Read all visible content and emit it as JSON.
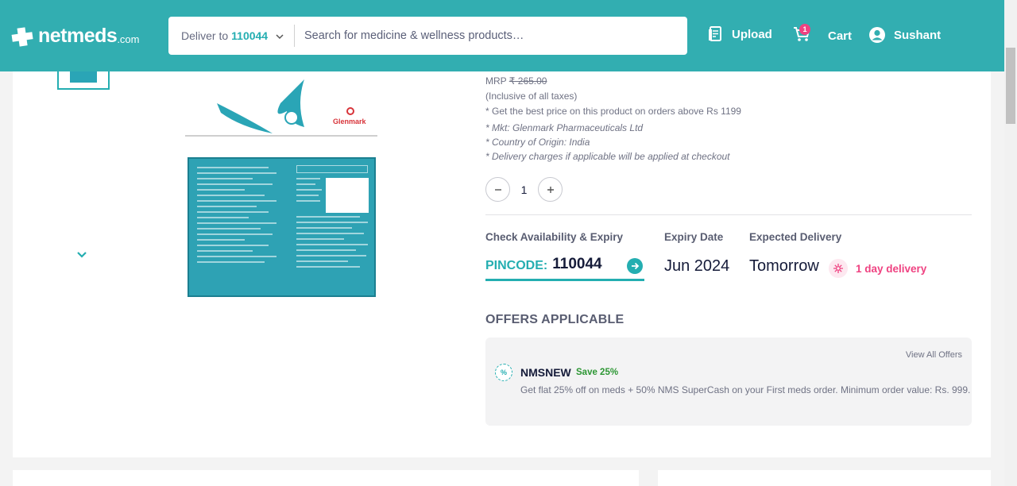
{
  "header": {
    "logo_text": "netmeds",
    "logo_suffix": ".com",
    "deliver_label": "Deliver to",
    "deliver_pincode": "110044",
    "search_placeholder": "Search for medicine & wellness products…",
    "upload_label": "Upload",
    "cart_label": "Cart",
    "cart_count": "1",
    "user_name": "Sushant"
  },
  "product": {
    "mrp_label": "MRP",
    "mrp_value": "₹ 265.00",
    "tax_note": "(Inclusive of all taxes)",
    "best_price_note": "* Get the best price on this product on orders above Rs 1199",
    "manufacturer": "* Mkt: Glenmark Pharmaceuticals Ltd",
    "origin": "* Country of Origin: India",
    "delivery_charges": "* Delivery charges if applicable will be applied at checkout",
    "quantity": "1",
    "brand_on_pack": "Glenmark"
  },
  "availability": {
    "check_label": "Check Availability & Expiry",
    "pincode_label": "PINCODE:",
    "pincode_value": "110044",
    "expiry_label": "Expiry Date",
    "expiry_value": "Jun 2024",
    "expected_label": "Expected Delivery",
    "expected_value": "Tomorrow",
    "delivery_tag": "1 day delivery"
  },
  "offers": {
    "title": "OFFERS APPLICABLE",
    "view_all": "View All Offers",
    "items": [
      {
        "code": "NMSNEW",
        "save": "Save 25%",
        "description": "Get flat 25% off on meds + 50% NMS SuperCash on your First meds order. Minimum order value: Rs. 999."
      }
    ]
  },
  "colors": {
    "brand": "#32aeb1",
    "accent": "#24aeb1",
    "pink": "#ef4281",
    "green": "#2c9633"
  }
}
